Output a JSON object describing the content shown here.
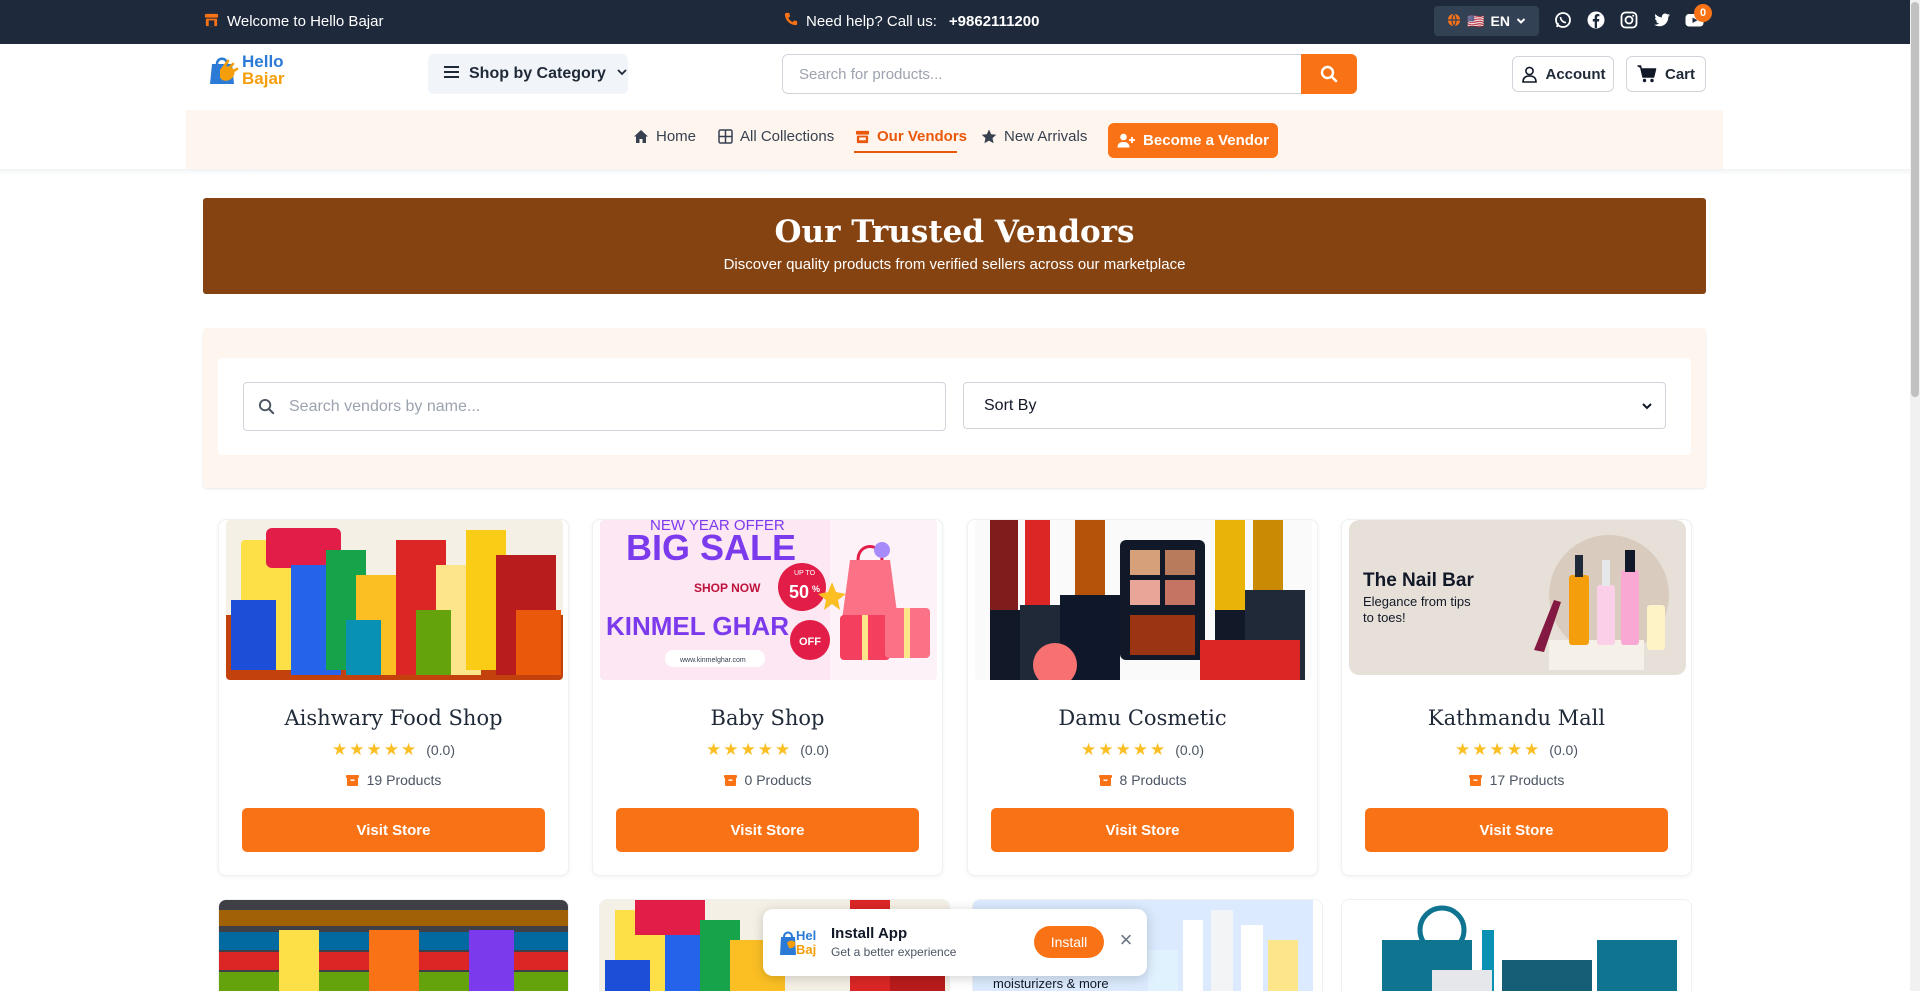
{
  "topbar": {
    "welcome": "Welcome to Hello Bajar",
    "help_text": "Need help? Call us:",
    "phone": "+9862111200",
    "language": "EN",
    "language_flag": "🇺🇸"
  },
  "header": {
    "logo_line1": "Hello",
    "logo_line2": "Bajar",
    "category_button": "Shop by Category",
    "search_placeholder": "Search for products...",
    "account_label": "Account",
    "cart_label": "Cart",
    "cart_count": "0"
  },
  "nav": {
    "items": [
      {
        "label": "Home"
      },
      {
        "label": "All Collections"
      },
      {
        "label": "Our Vendors"
      },
      {
        "label": "New Arrivals"
      }
    ],
    "become_vendor": "Become a Vendor"
  },
  "hero": {
    "title": "Our Trusted Vendors",
    "subtitle": "Discover quality products from verified sellers across our marketplace"
  },
  "filters": {
    "search_placeholder": "Search vendors by name...",
    "sort_label": "Sort By"
  },
  "vendors": [
    {
      "name": "Aishwary Food Shop",
      "rating": "(0.0)",
      "products": "19 Products",
      "button": "Visit Store"
    },
    {
      "name": "Baby Shop",
      "rating": "(0.0)",
      "products": "0 Products",
      "button": "Visit Store",
      "banner_top": "NEW YEAR OFFER",
      "banner_big": "BIG SALE",
      "banner_shop": "SHOP NOW",
      "banner_pct": "50",
      "banner_upto": "UP TO",
      "banner_brand": "KINMEL GHAR",
      "banner_off": "OFF",
      "banner_url": "www.kinmelghar.com"
    },
    {
      "name": "Damu Cosmetic",
      "rating": "(0.0)",
      "products": "8 Products",
      "button": "Visit Store"
    },
    {
      "name": "Kathmandu Mall",
      "rating": "(0.0)",
      "products": "17 Products",
      "button": "Visit Store",
      "banner_title": "The Nail Bar",
      "banner_sub1": "Elegance from tips",
      "banner_sub2": "to toes!"
    }
  ],
  "row2": {
    "card3_text": "moisturizers & more"
  },
  "install_popup": {
    "title": "Install App",
    "subtitle": "Get a better experience",
    "button": "Install",
    "logo_line1": "Hel",
    "logo_line2": "Baj"
  },
  "colors": {
    "accent": "#f97316",
    "topbar": "#1e293b",
    "hero": "#854312"
  }
}
